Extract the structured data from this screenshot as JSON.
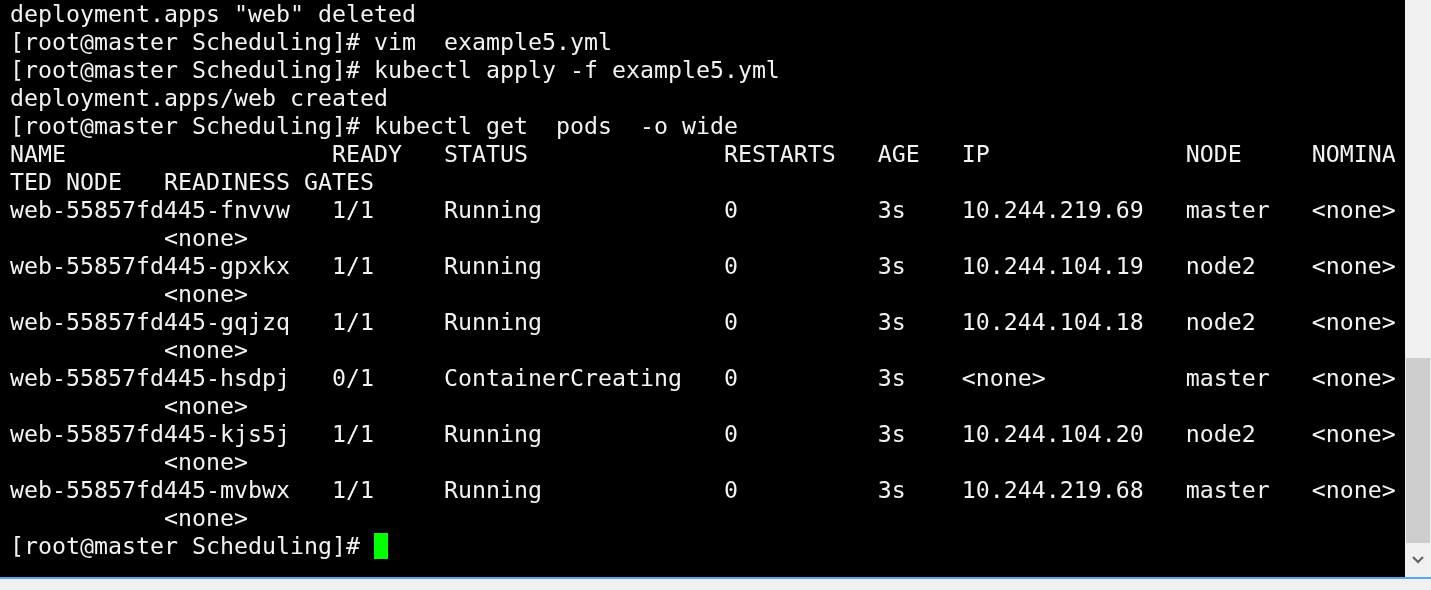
{
  "terminal": {
    "lines": [
      "deployment.apps \"web\" deleted",
      "[root@master Scheduling]# vim  example5.yml",
      "[root@master Scheduling]# kubectl apply -f example5.yml",
      "deployment.apps/web created",
      "[root@master Scheduling]# kubectl get  pods  -o wide",
      "NAME                   READY   STATUS              RESTARTS   AGE   IP              NODE     NOMINA",
      "TED NODE   READINESS GATES",
      "web-55857fd445-fnvvw   1/1     Running             0          3s    10.244.219.69   master   <none>",
      "           <none>",
      "web-55857fd445-gpxkx   1/1     Running             0          3s    10.244.104.19   node2    <none>",
      "           <none>",
      "web-55857fd445-gqjzq   1/1     Running             0          3s    10.244.104.18   node2    <none>",
      "           <none>",
      "web-55857fd445-hsdpj   0/1     ContainerCreating   0          3s    <none>          master   <none>",
      "           <none>",
      "web-55857fd445-kjs5j   1/1     Running             0          3s    10.244.104.20   node2    <none>",
      "           <none>",
      "web-55857fd445-mvbwx   1/1     Running             0          3s    10.244.219.68   master   <none>",
      "           <none>"
    ],
    "prompt": "[root@master Scheduling]#"
  }
}
